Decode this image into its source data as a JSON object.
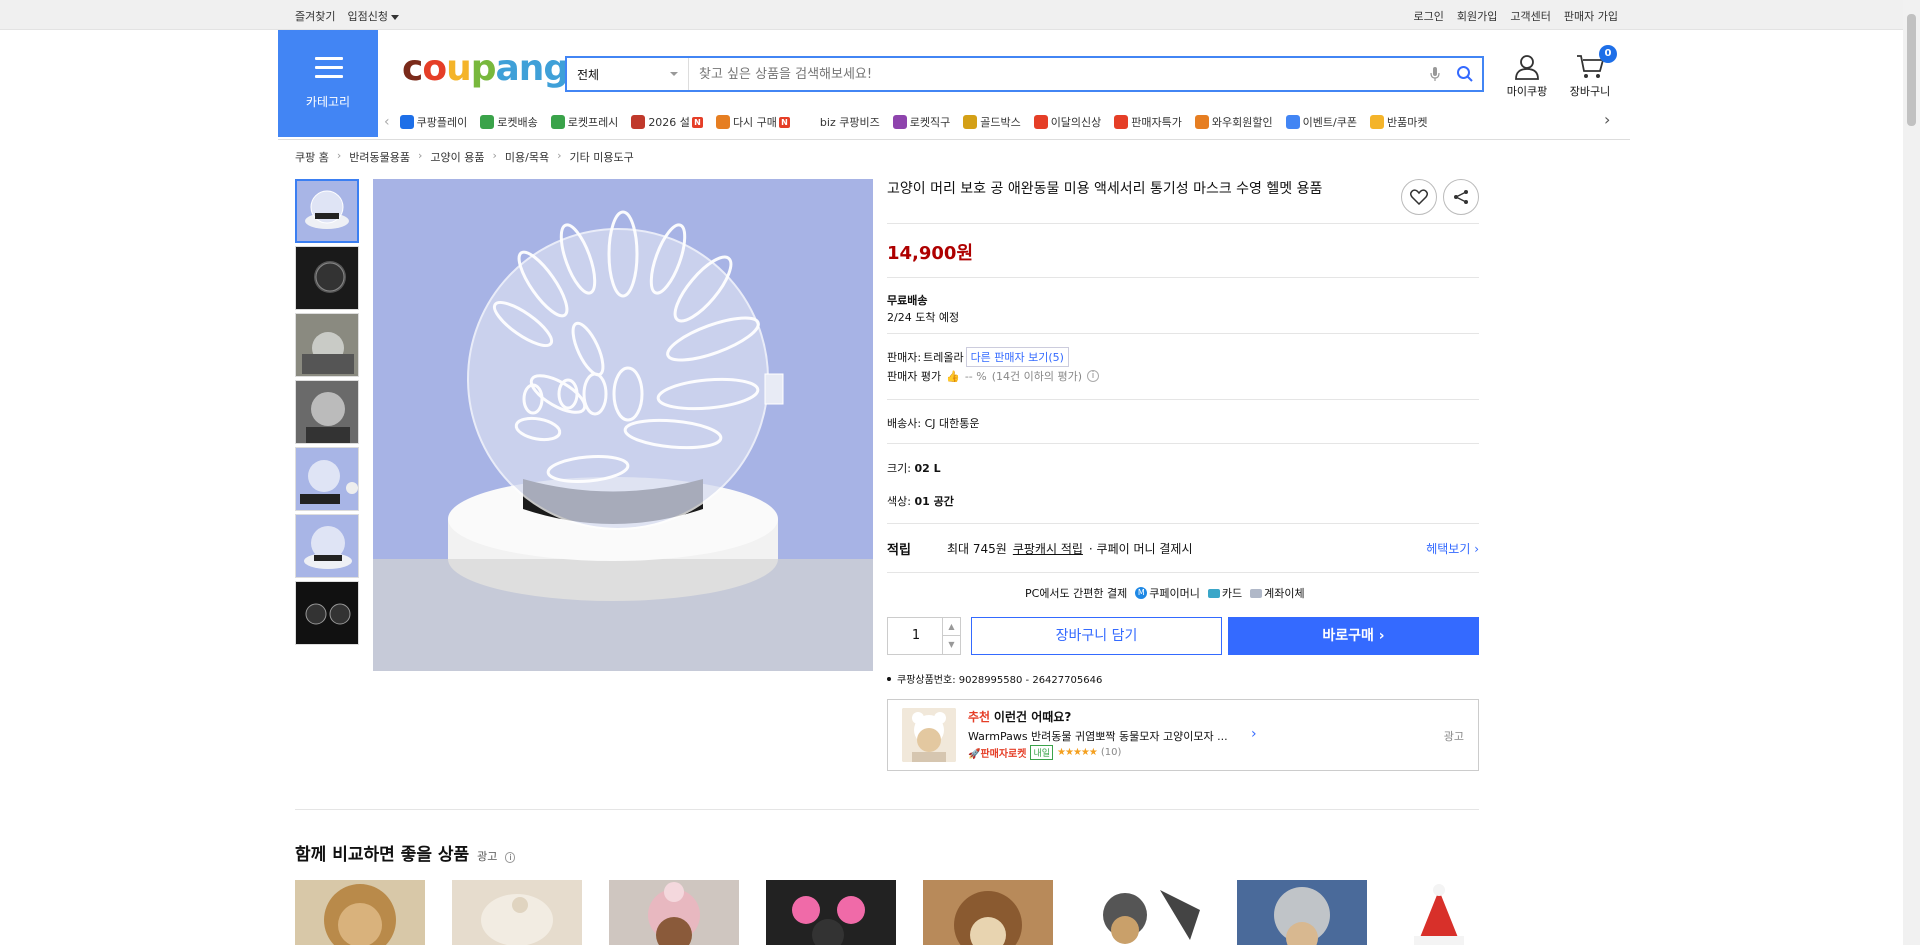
{
  "topbar": {
    "left": [
      "즐겨찾기",
      "입점신청"
    ],
    "right": [
      "로그인",
      "회원가입",
      "고객센터",
      "판매자 가입"
    ]
  },
  "header": {
    "category_label": "카테고리",
    "logo": [
      "c",
      "o",
      "u",
      "p",
      "ang"
    ],
    "search": {
      "select": "전체",
      "placeholder": "찾고 싶은 상품을 검색해보세요!"
    },
    "mycoupang": "마이쿠팡",
    "cart": "장바구니",
    "cart_count": "0"
  },
  "quicknav": [
    {
      "label": "쿠팡플레이",
      "color": "#1e6fe8",
      "new": false
    },
    {
      "label": "로켓배송",
      "color": "#3aa34a",
      "new": false
    },
    {
      "label": "로켓프레시",
      "color": "#3aa34a",
      "new": false
    },
    {
      "label": "2026 설",
      "color": "#c0392b",
      "new": true
    },
    {
      "label": "다시 구매",
      "color": "#e67e22",
      "new": true
    },
    {
      "label": "biz 쿠팡비즈",
      "color": "#ffffff",
      "new": false
    },
    {
      "label": "로켓직구",
      "color": "#8e44ad",
      "new": false
    },
    {
      "label": "골드박스",
      "color": "#d4a017",
      "new": false
    },
    {
      "label": "이달의신상",
      "color": "#e53e27",
      "new": false
    },
    {
      "label": "판매자특가",
      "color": "#e53e27",
      "new": false
    },
    {
      "label": "와우회원할인",
      "color": "#e67e22",
      "new": false
    },
    {
      "label": "이벤트/쿠폰",
      "color": "#4285f4",
      "new": false
    },
    {
      "label": "반품마켓",
      "color": "#f4b42a",
      "new": false
    }
  ],
  "breadcrumb": [
    "쿠팡 홈",
    "반려동물용품",
    "고양이 용품",
    "미용/목욕",
    "기타 미용도구"
  ],
  "product": {
    "title": "고양이 머리 보호 공 애완동물 미용 액세서리 통기성 마스크 수영 헬멧 용품",
    "price": "14,900원",
    "shipping_label": "무료배송",
    "arrival": "2/24 도착 예정",
    "seller_label": "판매자:",
    "seller_name": "트레올라",
    "other_sellers": "다른 판매자 보기(5)",
    "seller_rating_label": "판매자 평가",
    "seller_rating_value": "-- %",
    "seller_rating_note": "(14건 이하의 평가)",
    "courier_label": "배송사:",
    "courier": "CJ 대한통운",
    "size_label": "크기:",
    "size": "02 L",
    "color_label": "색상:",
    "color": "01 공간",
    "reward_label": "적립",
    "reward_prefix": "최대 745원",
    "reward_link": "쿠팡캐시 적립",
    "reward_suffix": "· 쿠페이 머니 결제시",
    "reward_more": "헤택보기",
    "pay_text": "PC에서도 간편한 결제",
    "pay_methods": [
      "쿠페이머니",
      "카드",
      "계좌이체"
    ],
    "quantity": "1",
    "add_cart": "장바구니 담기",
    "buy_now": "바로구매",
    "product_number": "쿠팡상품번호: 9028995580 - 26427705646"
  },
  "recommendation": {
    "tag": "추천",
    "headline": "이런건 어때요?",
    "name": "WarmPaws 반려동물 귀염뽀짝 동물모자 고양이모자 ...",
    "badge1": "판매자로켓",
    "badge2": "내일",
    "rating": 4.5,
    "review_count": "(10)",
    "ad": "광고"
  },
  "compare": {
    "title": "함께 비교하면 좋을 상품",
    "ad": "광고",
    "cards": [
      "lion-mane",
      "beige-hat",
      "pink-beanie",
      "pink-curlers",
      "bear-hood",
      "aviator-hat",
      "grey-knit-hat",
      "red-santa-hat"
    ]
  }
}
